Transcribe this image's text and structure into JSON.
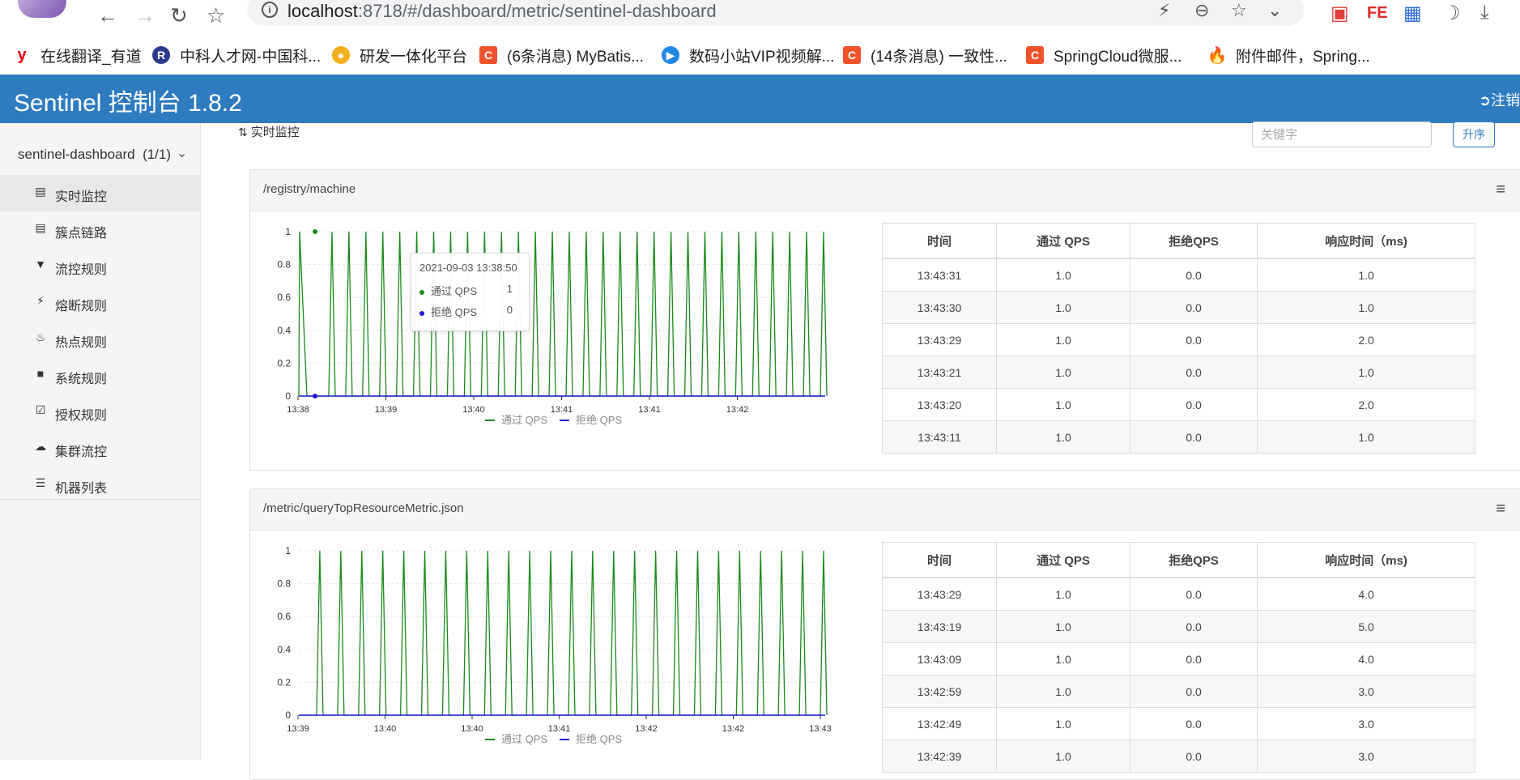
{
  "browser": {
    "url_host": "localhost",
    "url_rest": ":8718/#/dashboard/metric/sentinel-dashboard",
    "bookmarks": [
      {
        "label": "在线翻译_有道",
        "icon": "youdao-icon",
        "color": "#e00"
      },
      {
        "label": "中科人才网-中国科...",
        "icon": "zhongke-icon",
        "color": "#2b3a8c"
      },
      {
        "label": "研发一体化平台",
        "icon": "devops-icon",
        "color": "#f2b01e"
      },
      {
        "label": "(6条消息) MyBatis...",
        "icon": "csdn-icon",
        "color": "#f0522c"
      },
      {
        "label": "数码小站VIP视频解...",
        "icon": "video-icon",
        "color": "#1e88e5"
      },
      {
        "label": "(14条消息) 一致性...",
        "icon": "csdn-icon",
        "color": "#f0522c"
      },
      {
        "label": "SpringCloud微服...",
        "icon": "csdn-icon",
        "color": "#f0522c"
      },
      {
        "label": "附件邮件，Spring...",
        "icon": "fire-icon",
        "color": "#e53935"
      }
    ]
  },
  "app": {
    "title": "Sentinel 控制台 1.8.2",
    "logout": "注销"
  },
  "sidebar": {
    "app_name": "sentinel-dashboard",
    "app_count": "(1/1)",
    "items": [
      {
        "label": "实时监控",
        "icon": "bar-chart-icon",
        "active": true
      },
      {
        "label": "簇点链路",
        "icon": "list-icon",
        "active": false
      },
      {
        "label": "流控规则",
        "icon": "filter-icon",
        "active": false
      },
      {
        "label": "熔断规则",
        "icon": "flash-icon",
        "active": false
      },
      {
        "label": "热点规则",
        "icon": "fire-icon",
        "active": false
      },
      {
        "label": "系统规则",
        "icon": "lock-icon",
        "active": false
      },
      {
        "label": "授权规则",
        "icon": "check-icon",
        "active": false
      },
      {
        "label": "集群流控",
        "icon": "cloud-icon",
        "active": false
      },
      {
        "label": "机器列表",
        "icon": "th-list-icon",
        "active": false
      }
    ]
  },
  "main": {
    "title": "实时监控",
    "search_placeholder": "关键字",
    "sort_label": "升序",
    "table_headers": [
      "时间",
      "通过 QPS",
      "拒绝QPS",
      "响应时间（ms)"
    ],
    "legend": {
      "pass": "通过 QPS",
      "block": "拒绝 QPS"
    },
    "colors": {
      "pass": "#1a8a1a",
      "block": "#1a1ad0"
    }
  },
  "panels": [
    {
      "resource": "/registry/machine",
      "tooltip": {
        "time": "2021-09-03 13:38:50",
        "pass_label": "通过 QPS",
        "pass_value": "1",
        "block_label": "拒绝 QPS",
        "block_value": "0"
      },
      "chart_data": {
        "type": "line",
        "ylim": [
          0,
          1
        ],
        "y_ticks": [
          "0",
          "0.2",
          "0.4",
          "0.6",
          "0.8",
          "1"
        ],
        "x_ticks": [
          "13:38",
          "13:39",
          "13:40",
          "13:41",
          "13:41",
          "13:42"
        ],
        "spikes": 30,
        "series": [
          {
            "name": "通过 QPS",
            "values": [
              0,
              1
            ]
          },
          {
            "name": "拒绝 QPS",
            "values": [
              0
            ]
          }
        ]
      },
      "rows": [
        [
          "13:43:31",
          "1.0",
          "0.0",
          "1.0"
        ],
        [
          "13:43:30",
          "1.0",
          "0.0",
          "1.0"
        ],
        [
          "13:43:29",
          "1.0",
          "0.0",
          "2.0"
        ],
        [
          "13:43:21",
          "1.0",
          "0.0",
          "1.0"
        ],
        [
          "13:43:20",
          "1.0",
          "0.0",
          "2.0"
        ],
        [
          "13:43:11",
          "1.0",
          "0.0",
          "1.0"
        ]
      ]
    },
    {
      "resource": "/metric/queryTopResourceMetric.json",
      "chart_data": {
        "type": "line",
        "ylim": [
          0,
          1
        ],
        "y_ticks": [
          "0",
          "0.2",
          "0.4",
          "0.6",
          "0.8",
          "1"
        ],
        "x_ticks": [
          "13:39",
          "13:40",
          "13:40",
          "13:41",
          "13:42",
          "13:42",
          "13:43"
        ],
        "spikes": 25,
        "series": [
          {
            "name": "通过 QPS",
            "values": [
              0,
              1
            ]
          },
          {
            "name": "拒绝 QPS",
            "values": [
              0
            ]
          }
        ]
      },
      "rows": [
        [
          "13:43:29",
          "1.0",
          "0.0",
          "4.0"
        ],
        [
          "13:43:19",
          "1.0",
          "0.0",
          "5.0"
        ],
        [
          "13:43:09",
          "1.0",
          "0.0",
          "4.0"
        ],
        [
          "13:42:59",
          "1.0",
          "0.0",
          "3.0"
        ],
        [
          "13:42:49",
          "1.0",
          "0.0",
          "3.0"
        ],
        [
          "13:42:39",
          "1.0",
          "0.0",
          "3.0"
        ]
      ]
    }
  ]
}
